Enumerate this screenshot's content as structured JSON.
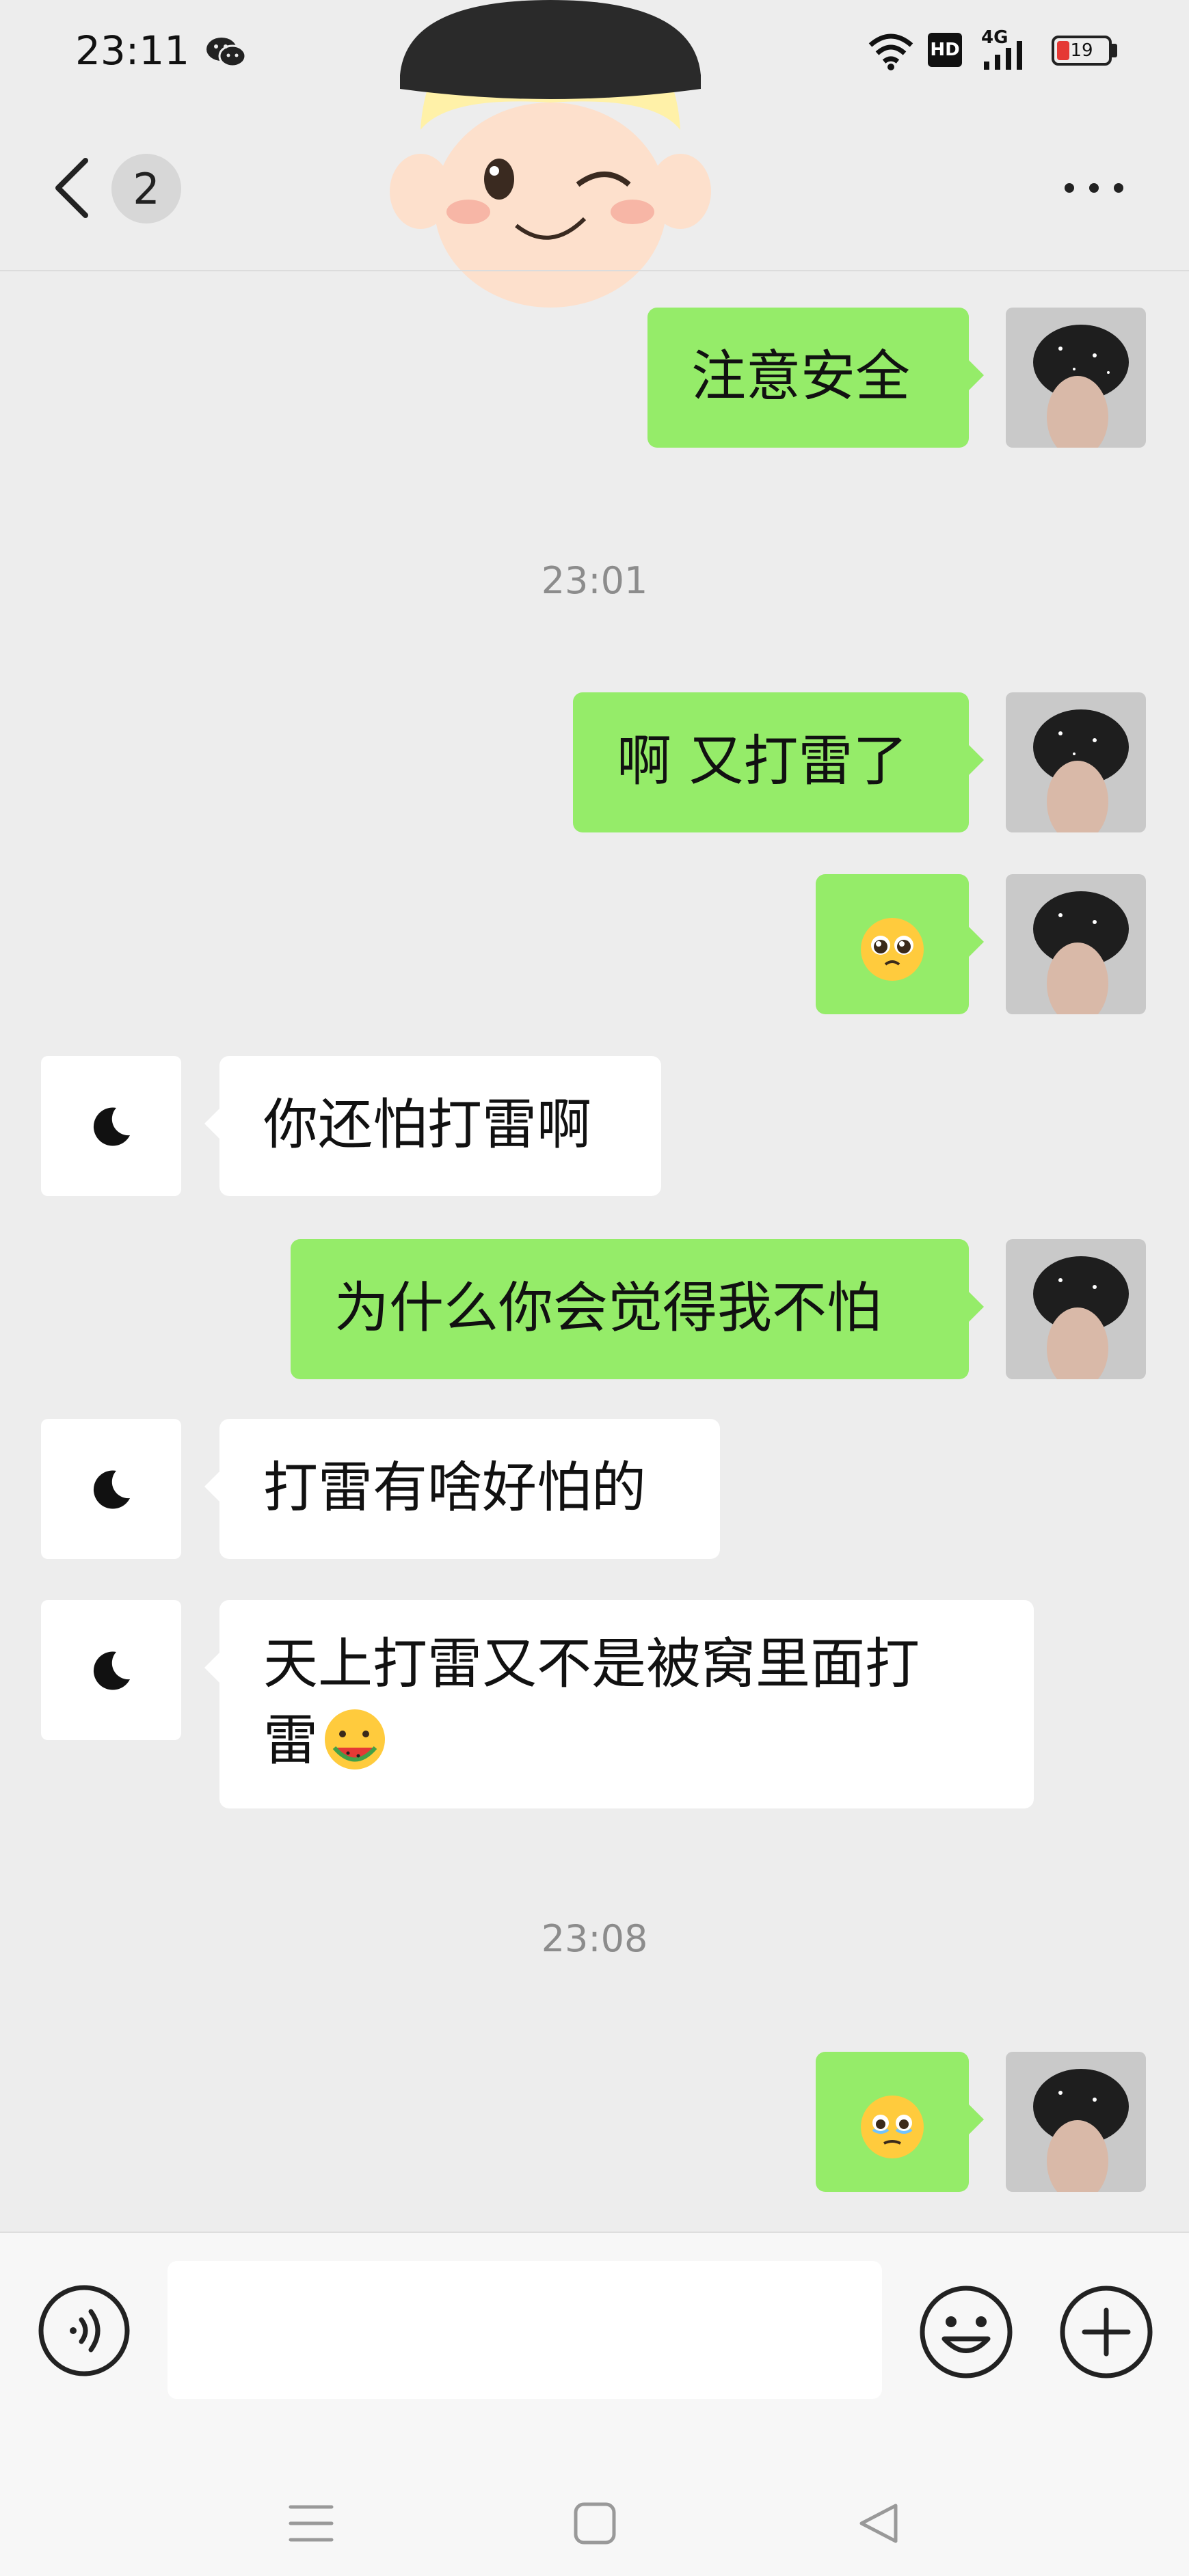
{
  "status_bar": {
    "time": "23:11",
    "network": "4G",
    "hd": "HD",
    "battery": "19"
  },
  "header": {
    "unread_count": "2"
  },
  "messages": [
    {
      "side": "me",
      "type": "text",
      "text": "注意安全"
    },
    {
      "type": "timestamp",
      "text": "23:01"
    },
    {
      "side": "me",
      "type": "text",
      "text": "啊 又打雷了"
    },
    {
      "side": "me",
      "type": "emoji",
      "emoji": "pleading-face"
    },
    {
      "side": "peer",
      "type": "text",
      "text": "你还怕打雷啊"
    },
    {
      "side": "me",
      "type": "text",
      "text": "为什么你会觉得我不怕"
    },
    {
      "side": "peer",
      "type": "text",
      "text": "打雷有啥好怕的"
    },
    {
      "side": "peer",
      "type": "text",
      "lines": [
        "天上打雷又不是被窝里面打",
        "雷"
      ],
      "trailing_emoji": "eating-watermelon-face"
    },
    {
      "type": "timestamp",
      "text": "23:08"
    },
    {
      "side": "me",
      "type": "emoji",
      "emoji": "holding-back-tears-face"
    }
  ],
  "input": {
    "value": "",
    "placeholder": ""
  },
  "colors": {
    "bubble_me": "#95ec69",
    "bubble_peer": "#ffffff",
    "background": "#ededed"
  }
}
